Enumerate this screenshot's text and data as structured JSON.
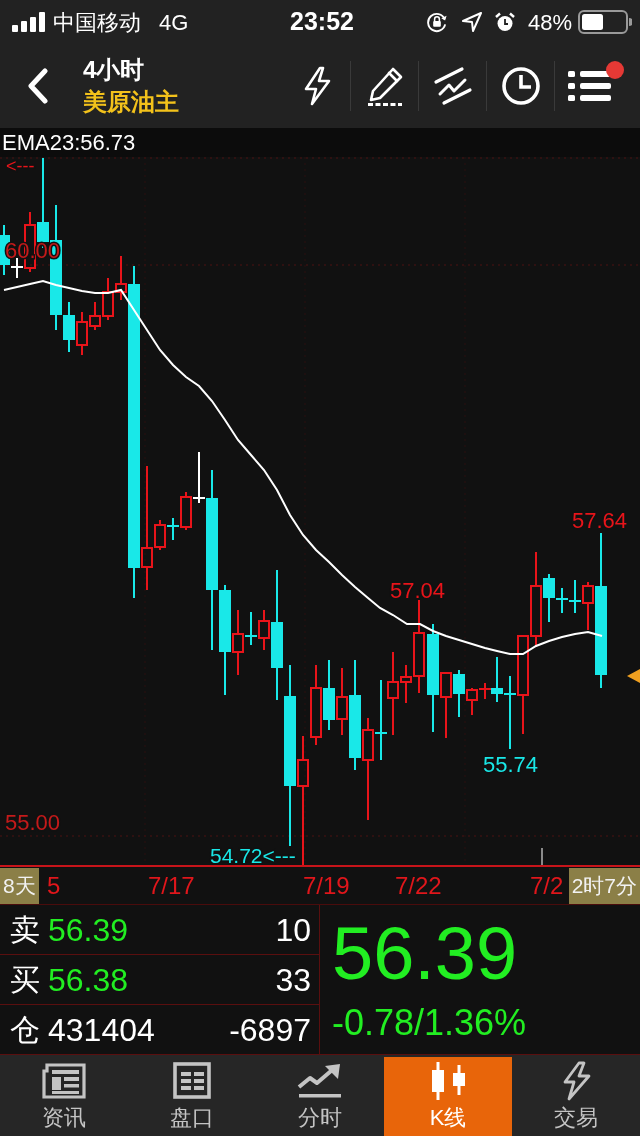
{
  "status_bar": {
    "carrier": "中国移动",
    "network": "4G",
    "time": "23:52",
    "battery": "48%"
  },
  "header": {
    "title": "4小时",
    "subtitle": "美原油主",
    "menu_notification": true
  },
  "chart": {
    "indicator": "EMA23:56.73",
    "labels": [
      {
        "text": "<---",
        "kind": "high"
      },
      {
        "text": "60.00",
        "kind": "axis"
      },
      {
        "text": "57.64",
        "kind": "high"
      },
      {
        "text": "57.04",
        "kind": "high"
      },
      {
        "text": "55.74",
        "kind": "low"
      },
      {
        "text": "55.00",
        "kind": "axis"
      },
      {
        "text": "54.72<---",
        "kind": "low"
      }
    ],
    "dates": [
      "5",
      "7/17",
      "7/19",
      "7/22",
      "7/2"
    ],
    "range_badge": "8天",
    "time_badge": "2时7分"
  },
  "quote": {
    "price_down": true,
    "rows": [
      {
        "label": "卖",
        "value": "56.39",
        "kind": "price",
        "volume": "10"
      },
      {
        "label": "买",
        "value": "56.38",
        "kind": "price",
        "volume": "33"
      },
      {
        "label": "仓",
        "value": "431404",
        "kind": "count",
        "volume": "-6897"
      }
    ],
    "last": "56.39",
    "change": "-0.78/1.36%"
  },
  "tabs": [
    {
      "label": "资讯",
      "selected": false
    },
    {
      "label": "盘口",
      "selected": false
    },
    {
      "label": "分时",
      "selected": false
    },
    {
      "label": "K线",
      "selected": true
    },
    {
      "label": "交易",
      "selected": false
    }
  ]
}
